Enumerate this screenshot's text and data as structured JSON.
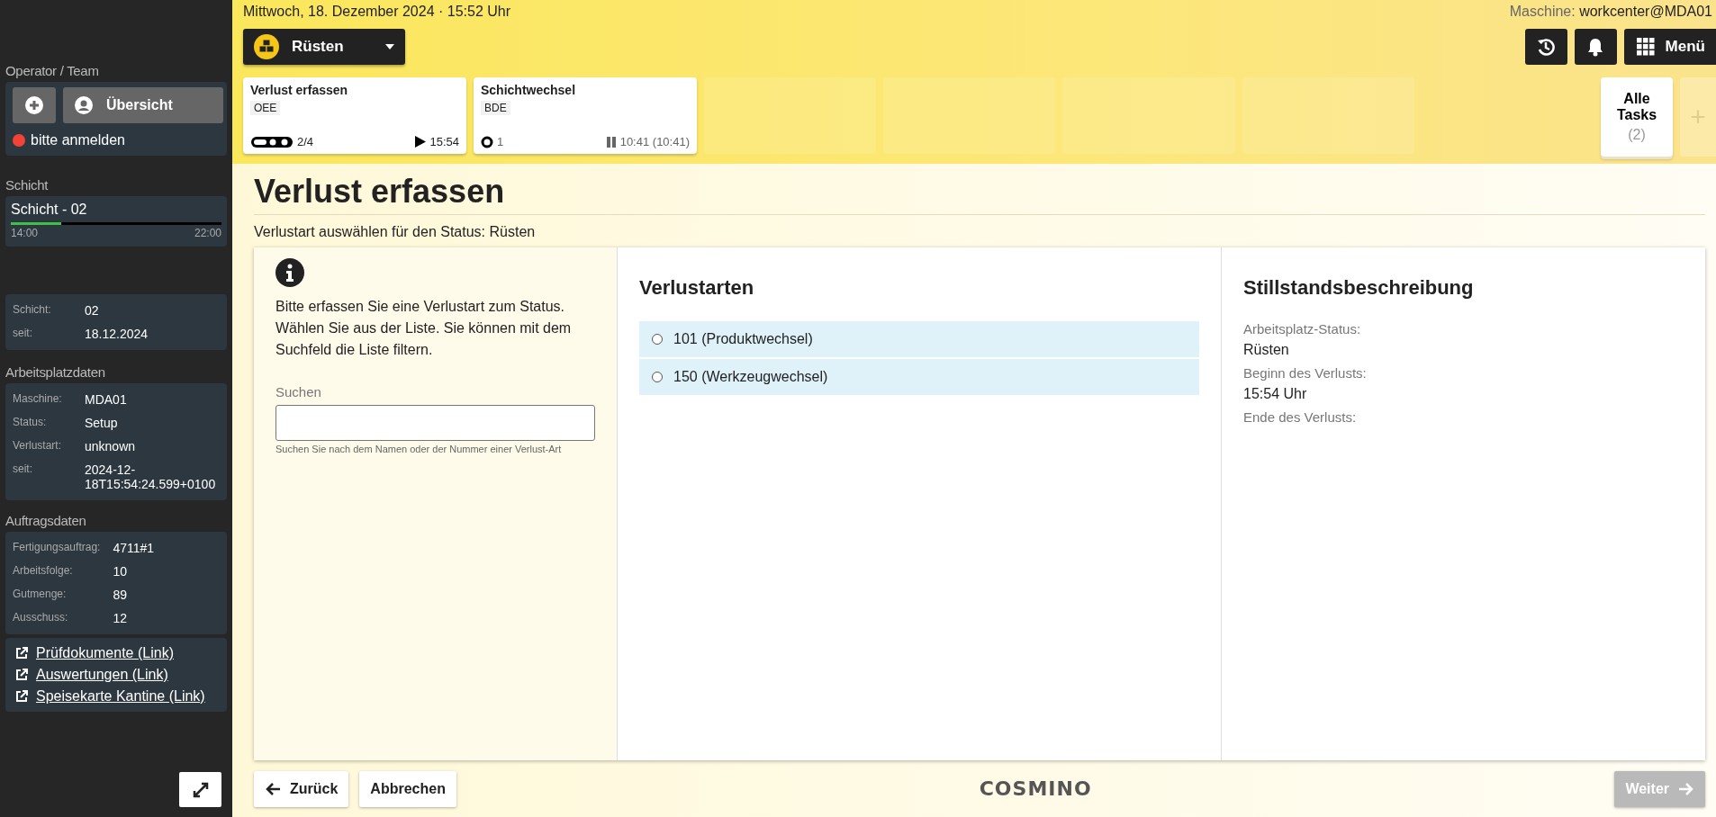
{
  "sidebar": {
    "operator": {
      "heading": "Operator / Team",
      "overview_button": "Übersicht",
      "status": "bitte anmelden",
      "logged_in": false
    },
    "shift": {
      "heading": "Schicht",
      "name": "Schicht - 02",
      "level": 0.24,
      "start": "14:00",
      "end": "22:00"
    },
    "shift_info": [
      {
        "label": "Schicht:",
        "value": "02"
      },
      {
        "label": "seit:",
        "value": "18.12.2024"
      }
    ],
    "workplace": {
      "heading": "Arbeitsplatzdaten",
      "rows": [
        {
          "label": "Maschine:",
          "value": "MDA01"
        },
        {
          "label": "Status:",
          "value": "Setup"
        },
        {
          "label": "Verlustart:",
          "value": "unknown"
        },
        {
          "label": "seit:",
          "value": "2024-12-18T15:54:24.599+0100"
        }
      ]
    },
    "order": {
      "heading": "Auftragsdaten",
      "rows": [
        {
          "label": "Fertigungsauftrag:",
          "value": "4711#1"
        },
        {
          "label": "Arbeitsfolge:",
          "value": "10"
        },
        {
          "label": "Gutmenge:",
          "value": "89"
        },
        {
          "label": "Ausschuss:",
          "value": "12"
        }
      ]
    },
    "links": [
      "Prüfdokumente (Link)",
      "Auswertungen (Link)",
      "Speisekarte Kantine (Link)"
    ]
  },
  "header": {
    "date": "Mittwoch, 18. Dezember 2024 · 15:52 Uhr",
    "machine_label": "Maschine:",
    "machine": "workcenter@MDA01",
    "status_button": "Rüsten",
    "menu_button": "Menü"
  },
  "tasks": [
    {
      "title": "Verlust erfassen",
      "tag": "OEE",
      "kind": "running",
      "count": "2/4",
      "time": "15:54"
    },
    {
      "title": "Schichtwechsel",
      "tag": "BDE",
      "kind": "paused",
      "count": "1",
      "time": "10:41 (10:41)"
    }
  ],
  "all_tasks": {
    "label": "Alle Tasks",
    "count": "(2)"
  },
  "add_task": "+",
  "page": {
    "title": "Verlust erfassen",
    "subtitle": "Verlustart auswählen für den Status: Rüsten"
  },
  "info": {
    "text": "Bitte erfassen Sie eine Verlustart zum Status. Wählen Sie aus der Liste. Sie können mit dem Suchfeld die Liste filtern.",
    "search_label": "Suchen",
    "search_hint": "Suchen Sie nach dem Namen oder der Nummer einer Verlust-Art"
  },
  "loss_types": {
    "heading": "Verlustarten",
    "items": [
      {
        "label": "101 (Produktwechsel)",
        "selected": false
      },
      {
        "label": "150 (Werkzeugwechsel)",
        "selected": false
      }
    ]
  },
  "downtime": {
    "heading": "Stillstandsbeschreibung",
    "fields": [
      {
        "label": "Arbeitsplatz-Status:",
        "value": "Rüsten"
      },
      {
        "label": "Beginn des Verlusts:",
        "value": "15:54 Uhr"
      },
      {
        "label": "Ende des Verlusts:"
      }
    ]
  },
  "footer": {
    "back": "Zurück",
    "cancel": "Abbrechen",
    "logo": "COSMINO",
    "next": "Weiter",
    "next_disabled": true
  }
}
